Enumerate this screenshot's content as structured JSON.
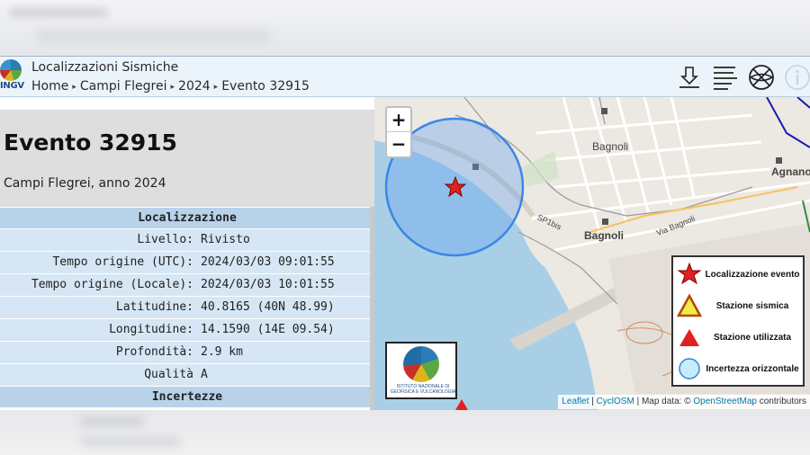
{
  "header": {
    "logo_text": "INGV",
    "title": "Localizzazioni Sismiche",
    "breadcrumb": [
      "Home",
      "Campi Flegrei",
      "2024",
      "Evento 32915"
    ],
    "separator": "▸",
    "icons": [
      "download-icon",
      "list-icon",
      "globe-icon",
      "info-icon"
    ]
  },
  "event": {
    "title": "Evento 32915",
    "subtitle": "Campi Flegrei, anno 2024"
  },
  "table": {
    "section_location": "Localizzazione",
    "rows": [
      {
        "key": "Livello:",
        "value": "Rivisto"
      },
      {
        "key": "Tempo origine (UTC):",
        "value": "2024/03/03 09:01:55"
      },
      {
        "key": "Tempo origine (Locale):",
        "value": "2024/03/03 10:01:55"
      },
      {
        "key": "Latitudine:",
        "value": "40.8165 (40N 48.99)"
      },
      {
        "key": "Longitudine:",
        "value": "14.1590 (14E 09.54)"
      },
      {
        "key": "Profondità:",
        "value": "2.9 km"
      },
      {
        "key": "Qualità",
        "value": "A"
      }
    ],
    "section_uncertainty": "Incertezze"
  },
  "map": {
    "zoom_in": "+",
    "zoom_out": "−",
    "places": [
      "Bagnoli",
      "Bagnoli",
      "Agnano",
      "SP1bis",
      "Via Bagnoli"
    ],
    "legend": [
      {
        "icon": "star-icon",
        "label": "Localizzazione evento"
      },
      {
        "icon": "yellow-triangle-icon",
        "label": "Stazione sismica"
      },
      {
        "icon": "red-triangle-icon",
        "label": "Stazione utilizzata"
      },
      {
        "icon": "circle-icon",
        "label": "Incertezza orizzontale"
      }
    ],
    "ingv_logo_text": "ISTITUTO NAZIONALE DI GEOFISICA E VULCANOLOGIA",
    "attribution": {
      "leaflet": "Leaflet",
      "sep1": " | ",
      "cyclosm": "CyclOSM",
      "mid": " | Map data: © ",
      "osm": "OpenStreetMap",
      "tail": " contributors"
    }
  },
  "colors": {
    "accent": "#2b7bd6",
    "header_bg": "#ecf4fb",
    "section_bg": "#b8d2ea",
    "row_bg": "#d6e6f4",
    "sea": "#a9cfe6",
    "event_star": "#e32020"
  }
}
